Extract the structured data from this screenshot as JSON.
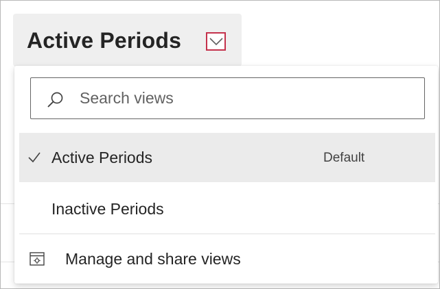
{
  "header": {
    "title": "Active Periods",
    "toggle_icon": "chevron-down-icon",
    "toggle_highlight_color": "#c4314b"
  },
  "menu": {
    "search": {
      "placeholder": "Search views",
      "value": "",
      "icon": "search-icon"
    },
    "items": [
      {
        "label": "Active Periods",
        "badge": "Default",
        "selected": true,
        "icon": "checkmark-icon"
      },
      {
        "label": "Inactive Periods",
        "badge": "",
        "selected": false
      }
    ],
    "manage": {
      "label": "Manage and share views",
      "icon": "settings-window-icon"
    }
  },
  "colors": {
    "selected_row": "#ebebeb",
    "header_bg": "#efefef",
    "text": "#242424"
  }
}
